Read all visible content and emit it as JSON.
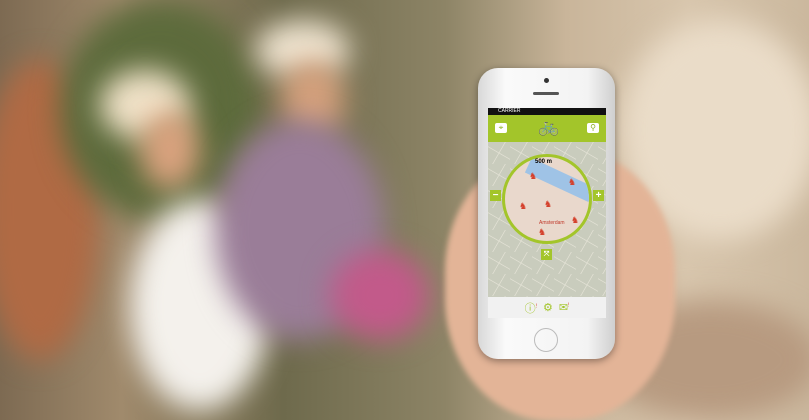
{
  "app": {
    "carrier": "CARRIER",
    "distance_label": "500 m",
    "city_label": "Amsterdam",
    "colors": {
      "accent": "#a3c52a",
      "marker": "#d4402c"
    },
    "icons": [
      "search-location-icon",
      "cyclists-logo-icon",
      "search-icon",
      "zoom-out-icon",
      "zoom-in-icon",
      "fit-icon",
      "alert-icon",
      "settings-icon",
      "mail-icon"
    ],
    "zoom_in": "+",
    "zoom_out": "−",
    "alert_badge": "!",
    "mail_badge": "!"
  }
}
